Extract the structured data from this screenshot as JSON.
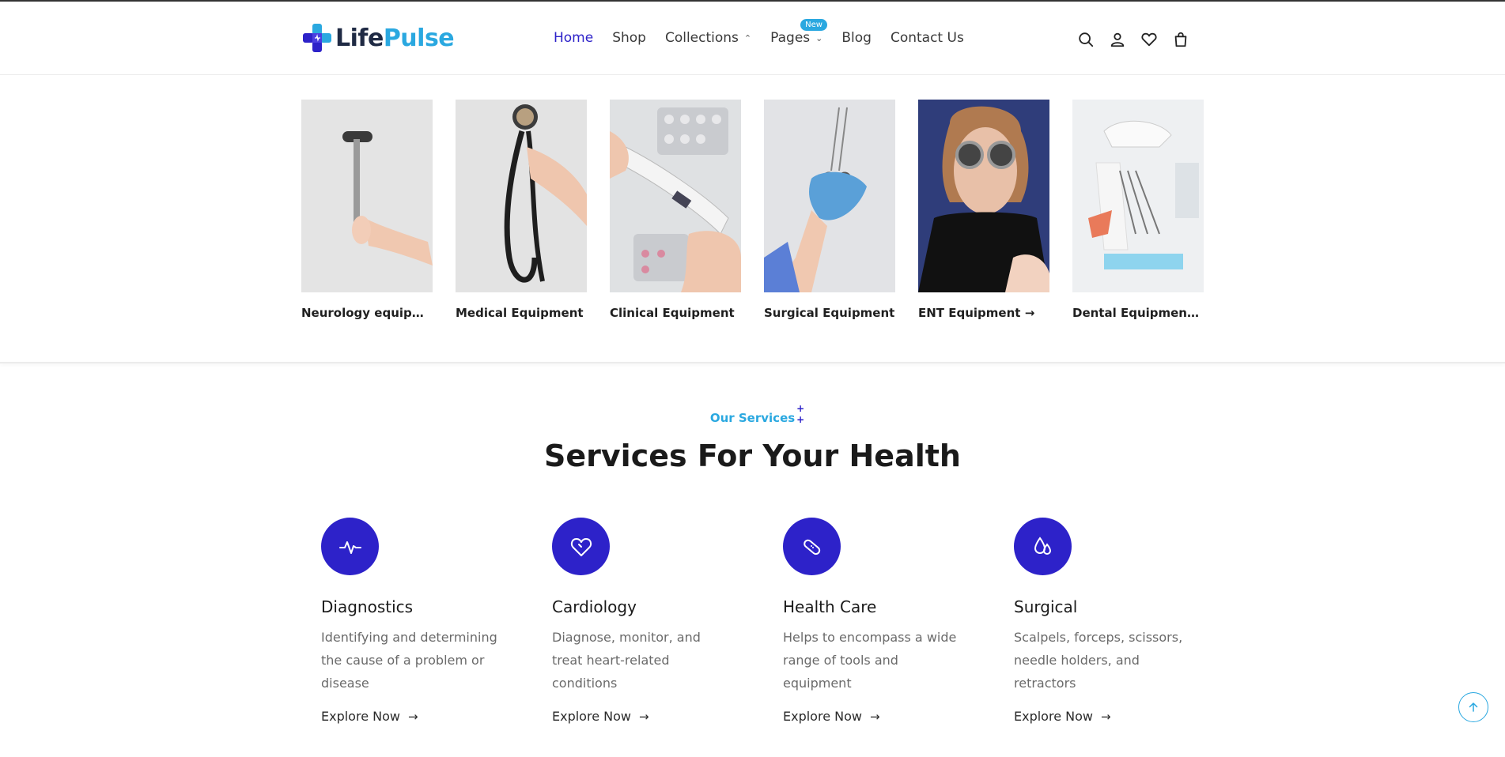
{
  "brand": {
    "name_part1": "Life",
    "name_part2": "Pulse",
    "accent": "#2d22c9",
    "secondary": "#2aa8e0"
  },
  "nav": {
    "items": [
      {
        "label": "Home",
        "active": true
      },
      {
        "label": "Shop"
      },
      {
        "label": "Collections",
        "icon": "chevron-up-icon"
      },
      {
        "label": "Pages",
        "icon": "chevron-down-icon",
        "badge": "New"
      },
      {
        "label": "Blog"
      },
      {
        "label": "Contact Us"
      }
    ]
  },
  "header_icons": [
    "search-icon",
    "user-icon",
    "heart-icon",
    "cart-icon"
  ],
  "categories": [
    {
      "label": "Neurology equipment",
      "image": "reflex-hammer"
    },
    {
      "label": "Medical Equipment",
      "image": "stethoscope"
    },
    {
      "label": "Clinical Equipment",
      "image": "thermometer"
    },
    {
      "label": "Surgical Equipment",
      "image": "scissors-glove"
    },
    {
      "label": "ENT Equipment",
      "arrow": "→",
      "image": "eye-test-glasses"
    },
    {
      "label": "Dental Equipment",
      "arrow": "→",
      "image": "dental-chair"
    }
  ],
  "services": {
    "eyebrow": "Our Services",
    "title": "Services For Your Health",
    "items": [
      {
        "title": "Diagnostics",
        "desc": "Identifying and determining the cause of a problem or disease",
        "link": "Explore Now",
        "icon": "pulse-icon"
      },
      {
        "title": "Cardiology",
        "desc": "Diagnose, monitor, and treat heart-related conditions",
        "link": "Explore Now",
        "icon": "heart-icon"
      },
      {
        "title": "Health Care",
        "desc": "Helps to encompass a wide range of tools and equipment",
        "link": "Explore Now",
        "icon": "bandage-icon"
      },
      {
        "title": "Surgical",
        "desc": "Scalpels, forceps, scissors, needle holders, and retractors",
        "link": "Explore Now",
        "icon": "drops-icon"
      }
    ]
  },
  "back_to_top_icon": "arrow-up-icon"
}
